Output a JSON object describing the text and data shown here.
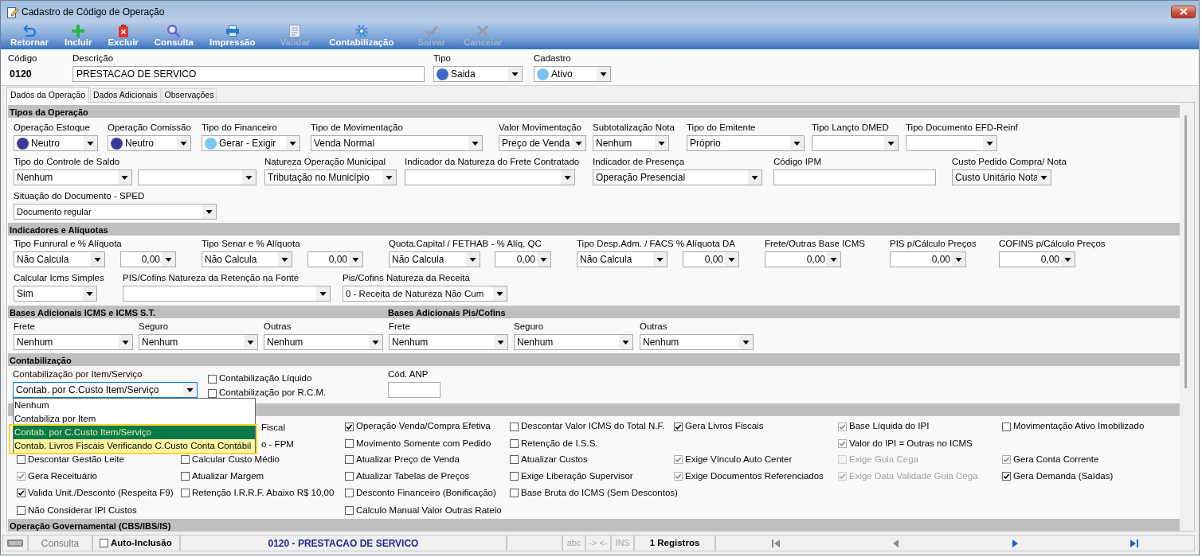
{
  "window": {
    "title": "Cadastro de Código de Operação"
  },
  "toolbar": [
    {
      "label": "Retornar",
      "kind": "return",
      "disabled": false
    },
    {
      "label": "Incluir",
      "kind": "add",
      "disabled": false
    },
    {
      "label": "Excluir",
      "kind": "delete",
      "disabled": false
    },
    {
      "label": "Consulta",
      "kind": "search",
      "disabled": false
    },
    {
      "label": "Impressão",
      "kind": "print",
      "disabled": false
    },
    {
      "label": "Validar",
      "kind": "validate",
      "disabled": true
    },
    {
      "label": "Contabilização",
      "kind": "accounting",
      "disabled": false
    },
    {
      "label": "Salvar",
      "kind": "save",
      "disabled": true
    },
    {
      "label": "Cancelar",
      "kind": "cancel",
      "disabled": true
    }
  ],
  "header": [
    {
      "kind": "static",
      "label": "Código",
      "value": "0120"
    },
    {
      "kind": "input",
      "label": "Descrição",
      "value": "PRESTACAO DE SERVICO"
    },
    {
      "kind": "select",
      "label": "Tipo",
      "value": "Saida",
      "color": "#3d6cc2"
    },
    {
      "kind": "select",
      "label": "Cadastro",
      "value": "Ativo",
      "color": "#7cc3ef"
    }
  ],
  "tabs": [
    {
      "label": "Dados da Operação",
      "selected": true
    },
    {
      "label": "Dados Adicionais",
      "selected": false
    },
    {
      "label": "Observações",
      "selected": false
    }
  ],
  "sections": [
    {
      "kind": "fields",
      "titles": [
        "Tipos da Operação"
      ],
      "lines": [
        {
          "fields": [
            {
              "kind": "select",
              "label": "Operação Estoque",
              "value": "Neutro",
              "color": "#3c3a98"
            },
            {
              "kind": "select",
              "label": "Operação Comissão",
              "value": "Neutro",
              "color": "#3c3a98"
            },
            {
              "kind": "select",
              "label": "Tipo do Financeiro",
              "value": "Gerar - Exigir",
              "color": "#7cc6f2"
            },
            {
              "kind": "select",
              "label": "Tipo de Movimentação",
              "value": "Venda Normal"
            },
            {
              "kind": "select",
              "label": "Valor Movimentação",
              "value": "Preço de Venda"
            },
            {
              "kind": "select",
              "label": "Subtotalização Nota",
              "value": "Nenhum"
            },
            {
              "kind": "select",
              "label": "Tipo do Emitente",
              "value": "Próprio"
            },
            {
              "kind": "select",
              "label": "Tipo Lançto DMED"
            },
            {
              "kind": "select",
              "label": "Tipo Documento EFD-Reinf"
            }
          ]
        },
        {
          "fields": [
            {
              "kind": "select",
              "label": "Tipo do Controle de Saldo",
              "value": "Nenhum"
            },
            {
              "kind": "select"
            },
            {
              "kind": "select",
              "label": "Natureza Operação Municipal",
              "value": "Tributação no Município"
            },
            {
              "kind": "select",
              "label": "Indicador da Natureza do Frete Contratado"
            },
            {
              "kind": "select",
              "label": "Indicador de Presença",
              "value": "Operação Presencial"
            },
            {
              "kind": "input",
              "label": "Código IPM"
            },
            {
              "kind": "select",
              "label": "Custo Pedido Compra/ Nota",
              "value": "Custo Unitário Nota"
            }
          ]
        },
        {
          "fields": [
            {
              "kind": "select",
              "label": "Situação do Documento - SPED",
              "value": "Documento regular"
            }
          ]
        }
      ]
    },
    {
      "kind": "fields",
      "titles": [
        "Indicadores e Alíquotas"
      ],
      "lines": [
        {
          "fields": [
            {
              "kind": "select",
              "label": "Tipo Funrural e % Alíquota",
              "value": "Não Calcula"
            },
            {
              "kind": "amount",
              "value": "0,00"
            },
            {
              "kind": "select",
              "label": "Tipo Senar e % Alíquota",
              "value": "Não Calcula"
            },
            {
              "kind": "amount",
              "value": "0,00"
            },
            {
              "kind": "select",
              "label": "Quota.Capital / FETHAB - % Alíq. QC",
              "value": "Não Calcula"
            },
            {
              "kind": "amount",
              "value": "0,00"
            },
            {
              "kind": "select",
              "label": "Tipo Desp.Adm. / FACS % Alíquota DA",
              "value": "Não Calcula"
            },
            {
              "kind": "amount",
              "value": "0,00"
            },
            {
              "kind": "amount",
              "label": "Frete/Outras Base ICMS",
              "value": "0,00"
            },
            {
              "kind": "amount",
              "label": "PIS p/Cálculo Preços",
              "value": "0,00"
            },
            {
              "kind": "amount",
              "label": "COFINS p/Cálculo Preços",
              "value": "0,00"
            }
          ]
        },
        {
          "fields": [
            {
              "kind": "select",
              "label": "Calcular Icms Simples",
              "value": "Sim"
            },
            {
              "kind": "select",
              "label": "PIS/Cofins Natureza da Retenção na Fonte"
            },
            {
              "kind": "select",
              "label": "Pis/Cofins Natureza da Receita",
              "value": "0 - Receita de Natureza Não Cum"
            }
          ]
        }
      ]
    },
    {
      "kind": "fields",
      "titles": [
        "Bases Adicionais ICMS e ICMS S.T.",
        "Bases Adicionais Pis/Cofins"
      ],
      "lines": [
        {
          "fields": [
            {
              "kind": "select",
              "label": "Frete",
              "value": "Nenhum"
            },
            {
              "kind": "select",
              "label": "Seguro",
              "value": "Nenhum"
            },
            {
              "kind": "select",
              "label": "Outras",
              "value": "Nenhum"
            },
            {
              "kind": "select",
              "label": "Frete",
              "value": "Nenhum"
            },
            {
              "kind": "select",
              "label": "Seguro",
              "value": "Nenhum"
            },
            {
              "kind": "select",
              "label": "Outras",
              "value": "Nenhum"
            }
          ]
        }
      ]
    },
    {
      "kind": "accounting",
      "titles": [
        "Contabilização"
      ],
      "select": {
        "label": "Contabilização por Item/Serviço",
        "value": "Contab. por C.Custo Item/Serviço",
        "focused": true,
        "expanded": true,
        "options": [
          {
            "label": "Nenhum",
            "selected": false,
            "highlighted": false
          },
          {
            "label": "Contabiliza por Item",
            "selected": false,
            "highlighted": false
          },
          {
            "label": "Contab. por C.Custo Item/Serviço",
            "selected": true,
            "highlighted": true
          },
          {
            "label": "Contab. Livros Fiscais Verificando C.Custo Conta Contábil",
            "selected": false,
            "highlighted": true
          }
        ]
      },
      "checks": [
        {
          "label": "Contabilização Líquido",
          "checked": false
        },
        {
          "label": "Contabilização por R.C.M.",
          "checked": false
        }
      ],
      "input": {
        "label": "Cód. ANP"
      }
    },
    {
      "kind": "options",
      "rows": [
        [
          {
            "kind": "blank"
          },
          {
            "kind": "covered",
            "label": "Fiscal"
          },
          {
            "kind": "checkbox",
            "label": "Operação Venda/Compra Efetiva",
            "checked": true,
            "read_only": false,
            "disabled": false
          },
          {
            "kind": "checkbox",
            "label": "Descontar Valor ICMS do Total N.F.",
            "checked": false,
            "read_only": false,
            "disabled": false
          },
          {
            "kind": "checkbox",
            "label": "Gera Livros Fiscais",
            "checked": true,
            "read_only": false,
            "disabled": false
          },
          {
            "kind": "checkbox",
            "label": "Base Líquida do IPI",
            "checked": true,
            "read_only": true,
            "disabled": false
          },
          {
            "kind": "checkbox",
            "label": "Movimentação Ativo Imobilizado",
            "checked": false,
            "read_only": false,
            "disabled": false
          }
        ],
        [
          {
            "kind": "blank"
          },
          {
            "kind": "covered",
            "label": "o - FPM"
          },
          {
            "kind": "checkbox",
            "label": "Movimento Somente com Pedido",
            "checked": false,
            "read_only": false,
            "disabled": false
          },
          {
            "kind": "checkbox",
            "label": "Retenção de I.S.S.",
            "checked": false,
            "read_only": false,
            "disabled": false
          },
          {
            "kind": "blank"
          },
          {
            "kind": "checkbox",
            "label": "Valor do IPI = Outras no ICMS",
            "checked": true,
            "read_only": true,
            "disabled": false
          }
        ],
        [
          {
            "kind": "checkbox",
            "label": "Descontar Gestão Leite",
            "checked": false,
            "read_only": false,
            "disabled": false
          },
          {
            "kind": "checkbox",
            "label": "Calcular Custo Médio",
            "checked": false,
            "read_only": false,
            "disabled": false
          },
          {
            "kind": "checkbox",
            "label": "Atualizar Preço de Venda",
            "checked": false,
            "read_only": false,
            "disabled": false
          },
          {
            "kind": "checkbox",
            "label": "Atualizar Custos",
            "checked": false,
            "read_only": false,
            "disabled": false
          },
          {
            "kind": "checkbox",
            "label": "Exige Vínculo Auto Center",
            "checked": true,
            "read_only": true,
            "disabled": false
          },
          {
            "kind": "checkbox",
            "label": "Exige Guia Cega",
            "checked": false,
            "read_only": false,
            "disabled": true
          },
          {
            "kind": "checkbox",
            "label": "Gera Conta Corrente",
            "checked": true,
            "read_only": true,
            "disabled": false
          }
        ],
        [
          {
            "kind": "checkbox",
            "label": "Gera Receituário",
            "checked": true,
            "read_only": true,
            "disabled": false
          },
          {
            "kind": "checkbox",
            "label": "Atualizar Margem",
            "checked": false,
            "read_only": false,
            "disabled": false
          },
          {
            "kind": "checkbox",
            "label": "Atualizar Tabelas de Preços",
            "checked": false,
            "read_only": false,
            "disabled": false
          },
          {
            "kind": "checkbox",
            "label": "Exige Liberação Supervisor",
            "checked": false,
            "read_only": false,
            "disabled": false
          },
          {
            "kind": "checkbox",
            "label": "Exige Documentos Referenciados",
            "checked": true,
            "read_only": true,
            "disabled": false
          },
          {
            "kind": "checkbox",
            "label": "Exige Data Validade Guia Cega",
            "checked": true,
            "read_only": false,
            "disabled": true
          },
          {
            "kind": "checkbox",
            "label": "Gera Demanda (Saídas)",
            "checked": true,
            "read_only": false,
            "disabled": false
          }
        ],
        [
          {
            "kind": "checkbox",
            "label": "Valida Unit./Desconto (Respeita F9)",
            "checked": true,
            "read_only": false,
            "disabled": false
          },
          {
            "kind": "checkbox",
            "label": "Retenção I.R.R.F. Abaixo R$ 10,00",
            "checked": false,
            "read_only": false,
            "disabled": false
          },
          {
            "kind": "checkbox",
            "label": "Desconto Financeiro (Bonificação)",
            "checked": false,
            "read_only": false,
            "disabled": false
          },
          {
            "kind": "checkbox",
            "label": "Base Bruta do ICMS (Sem Descontos)",
            "checked": false,
            "read_only": false,
            "disabled": false
          }
        ],
        [
          {
            "kind": "checkbox",
            "label": "Não Considerar IPI Custos",
            "checked": false,
            "read_only": false,
            "disabled": false
          },
          {
            "kind": "blank"
          },
          {
            "kind": "checkbox",
            "label": "Calculo Manual Valor Outras Rateio",
            "checked": false,
            "read_only": false,
            "disabled": false
          }
        ]
      ]
    },
    {
      "kind": "fields",
      "titles": [
        "Operação Governamental (CBS/IBS/IS)"
      ]
    }
  ],
  "status_bar": {
    "mode": {
      "label": "Consulta",
      "disabled": true
    },
    "auto_inclusion": {
      "label": "Auto-Inclusão",
      "checked": false
    },
    "record": "0120 - PRESTACAO DE SERVICO",
    "indicators": [
      {
        "label": "abc",
        "on": false
      },
      {
        "label": "-> <-",
        "on": false
      },
      {
        "label": "INS",
        "on": false
      }
    ],
    "count": "1 Registros",
    "navigation": [
      {
        "kind": "first",
        "disabled": true
      },
      {
        "kind": "previous",
        "disabled": true
      },
      {
        "kind": "next",
        "disabled": false
      },
      {
        "kind": "last",
        "disabled": false
      }
    ]
  }
}
